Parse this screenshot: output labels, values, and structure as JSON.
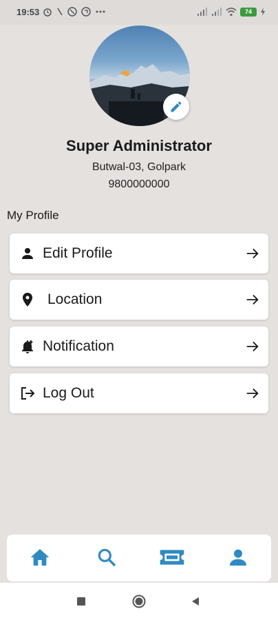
{
  "status_bar": {
    "time": "19:53",
    "battery": "74"
  },
  "profile": {
    "name": "Super Administrator",
    "address": "Butwal-03, Golpark",
    "phone": "9800000000"
  },
  "section_title": "My Profile",
  "menu": [
    {
      "label": "Edit Profile",
      "icon": "person-icon"
    },
    {
      "label": "Location",
      "icon": "location-pin-icon"
    },
    {
      "label": "Notification",
      "icon": "bell-plus-icon"
    },
    {
      "label": "Log Out",
      "icon": "logout-icon"
    }
  ],
  "bottom_nav": [
    {
      "name": "home",
      "icon": "home-icon"
    },
    {
      "name": "search",
      "icon": "search-icon"
    },
    {
      "name": "ticket",
      "icon": "ticket-icon"
    },
    {
      "name": "profile",
      "icon": "profile-icon"
    }
  ],
  "colors": {
    "background": "#e4e1df",
    "nav_icon": "#2f8ac4",
    "accent": "#2f8ac4"
  }
}
